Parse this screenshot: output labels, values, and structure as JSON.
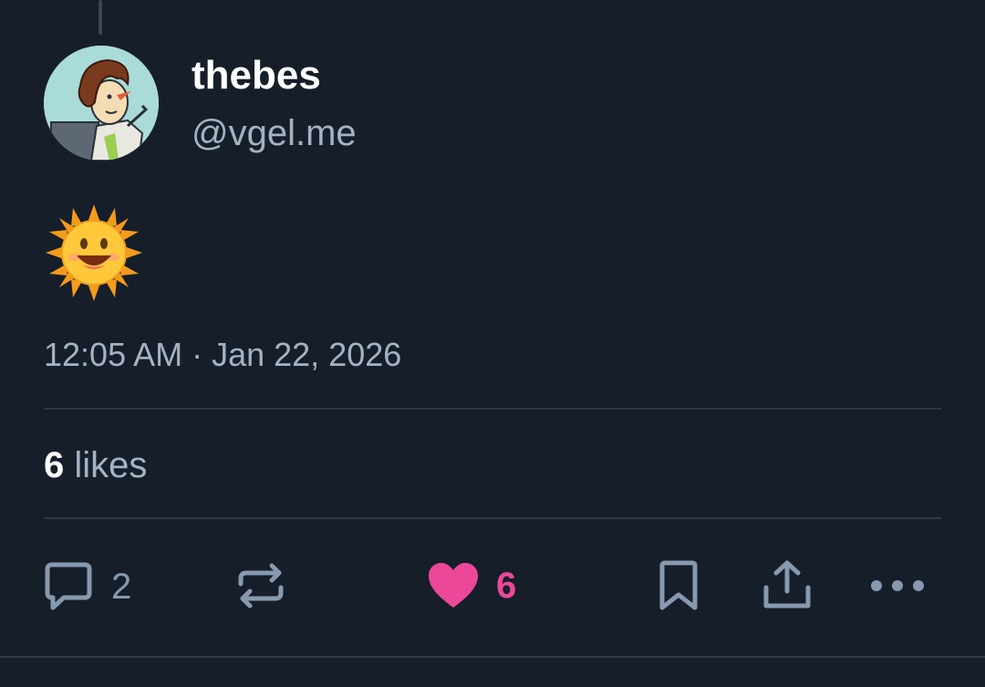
{
  "post": {
    "author": {
      "display_name": "thebes",
      "handle": "@vgel.me"
    },
    "content_emoji": "sun-with-face",
    "timestamp": "12:05 AM · Jan 22, 2026",
    "likes": {
      "count": "6",
      "label": "likes"
    }
  },
  "actions": {
    "reply": {
      "icon": "reply-icon",
      "count": "2"
    },
    "repost": {
      "icon": "repost-icon"
    },
    "like": {
      "icon": "heart-icon",
      "count": "6",
      "active": true
    },
    "bookmark": {
      "icon": "bookmark-icon"
    },
    "share": {
      "icon": "share-icon"
    },
    "more": {
      "icon": "more-icon"
    }
  },
  "colors": {
    "background": "#161e29",
    "text_primary": "#ffffff",
    "text_secondary": "#a4b2c4",
    "icon": "#8799ae",
    "like_active": "#ec4899",
    "divider": "#2c3948"
  }
}
